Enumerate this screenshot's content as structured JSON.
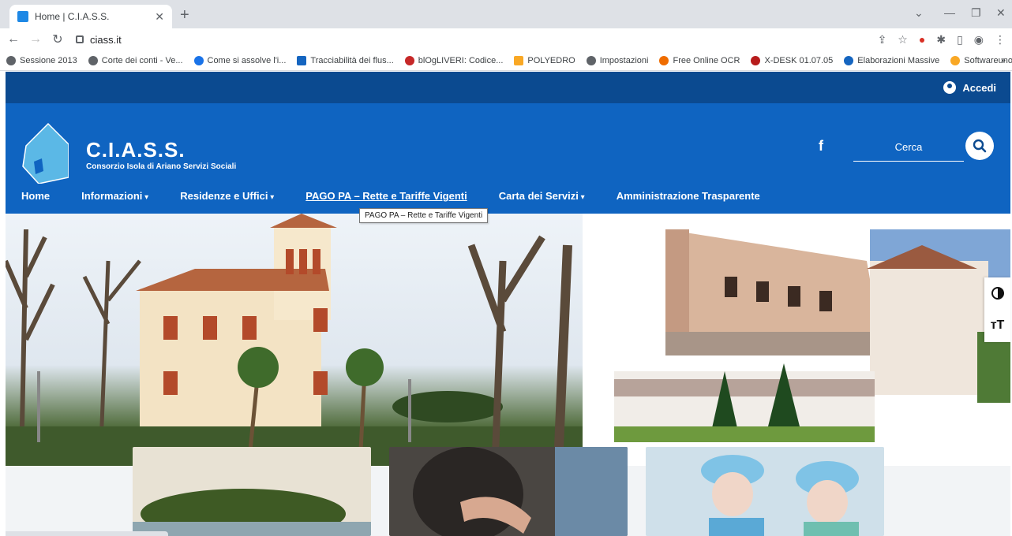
{
  "browser": {
    "tab_title": "Home | C.I.A.S.S.",
    "url": "ciass.it",
    "bookmarks": [
      "Sessione 2013",
      "Corte dei conti - Ve...",
      "Come si assolve l'i...",
      "Tracciabilità dei flus...",
      "blOgLIVERI: Codice...",
      "POLYEDRO",
      "Impostazioni",
      "Free Online OCR",
      "X-DESK 01.07.05",
      "Elaborazioni Massive",
      "Softwareuno - Port..."
    ]
  },
  "site": {
    "login_label": "Accedi",
    "brand_name": "C.I.A.S.S.",
    "brand_subtitle": "Consorzio Isola di Ariano Servizi Sociali",
    "facebook_label": "f",
    "search_placeholder": "Cerca",
    "nav": [
      "Home",
      "Informazioni",
      "Residenze e Uffici",
      "PAGO PA – Rette e Tariffe Vigenti",
      "Carta dei Servizi",
      "Amministrazione Trasparente"
    ],
    "tooltip": "PAGO PA – Rette e Tariffe Vigenti"
  },
  "colors": {
    "topbar": "#0b4a90",
    "header": "#0f64c1",
    "house_logo": "#5bb8e6"
  }
}
